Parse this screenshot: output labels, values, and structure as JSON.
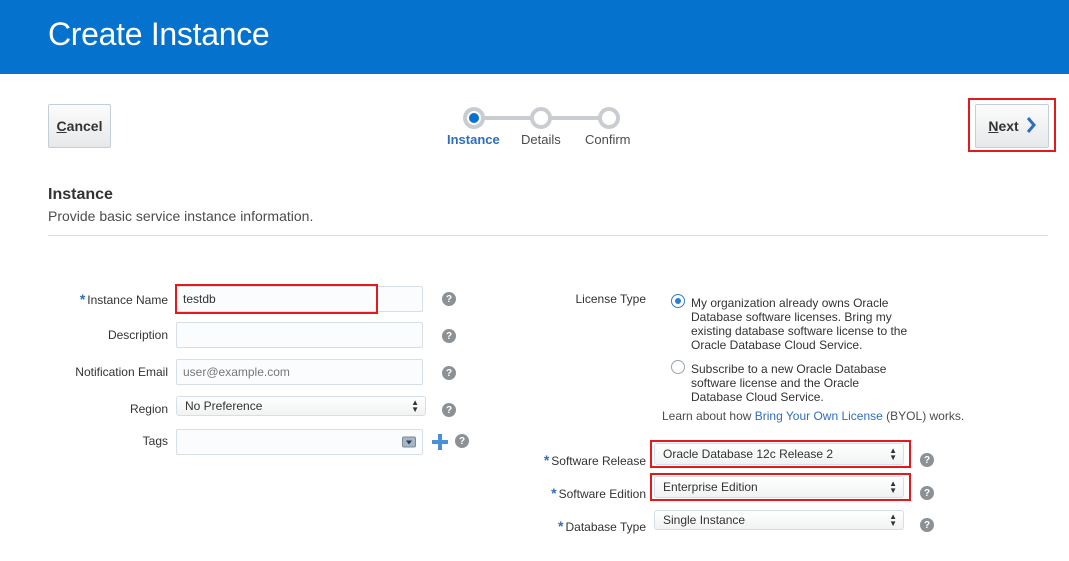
{
  "header": {
    "title": "Create Instance",
    "bg_color": "#0572ce"
  },
  "toolbar": {
    "cancel_mnemonic": "C",
    "cancel_rest": "ancel",
    "next_mnemonic": "N",
    "next_rest": "ext"
  },
  "train": {
    "steps": [
      {
        "label": "Instance",
        "active": true
      },
      {
        "label": "Details",
        "active": false
      },
      {
        "label": "Confirm",
        "active": false
      }
    ]
  },
  "section": {
    "title": "Instance",
    "description": "Provide basic service instance information."
  },
  "form_left": {
    "instance_name": {
      "label": "Instance Name",
      "value": "testdb",
      "required": true
    },
    "description": {
      "label": "Description",
      "value": ""
    },
    "notification_email": {
      "label": "Notification Email",
      "placeholder": "user@example.com"
    },
    "region": {
      "label": "Region",
      "value": "No Preference"
    },
    "tags": {
      "label": "Tags",
      "value": ""
    }
  },
  "form_right": {
    "license_type": {
      "label": "License Type",
      "options": [
        {
          "line1": "My organization already owns Oracle",
          "line2": "Database software licenses. Bring my",
          "line3": "existing database software license to the",
          "line4": "Oracle Database Cloud Service.",
          "selected": true
        },
        {
          "line1": "Subscribe to a new Oracle Database",
          "line2": "software license and the Oracle",
          "line3": "Database Cloud Service.",
          "selected": false
        }
      ],
      "byol_prefix": "Learn about how ",
      "byol_link": "Bring Your Own License",
      "byol_suffix": " (BYOL) works."
    },
    "software_release": {
      "label": "Software Release",
      "value": "Oracle Database 12c Release 2",
      "required": true
    },
    "software_edition": {
      "label": "Software Edition",
      "value": "Enterprise Edition",
      "required": true
    },
    "database_type": {
      "label": "Database Type",
      "value": "Single Instance",
      "required": true
    }
  },
  "required_marker": "*",
  "help_glyph": "?",
  "highlight_color": "#e3191c",
  "icons": [
    "chevron-right-icon",
    "help-icon",
    "plus-icon",
    "dropdown-arrow-icon",
    "updown-arrow-icon"
  ]
}
